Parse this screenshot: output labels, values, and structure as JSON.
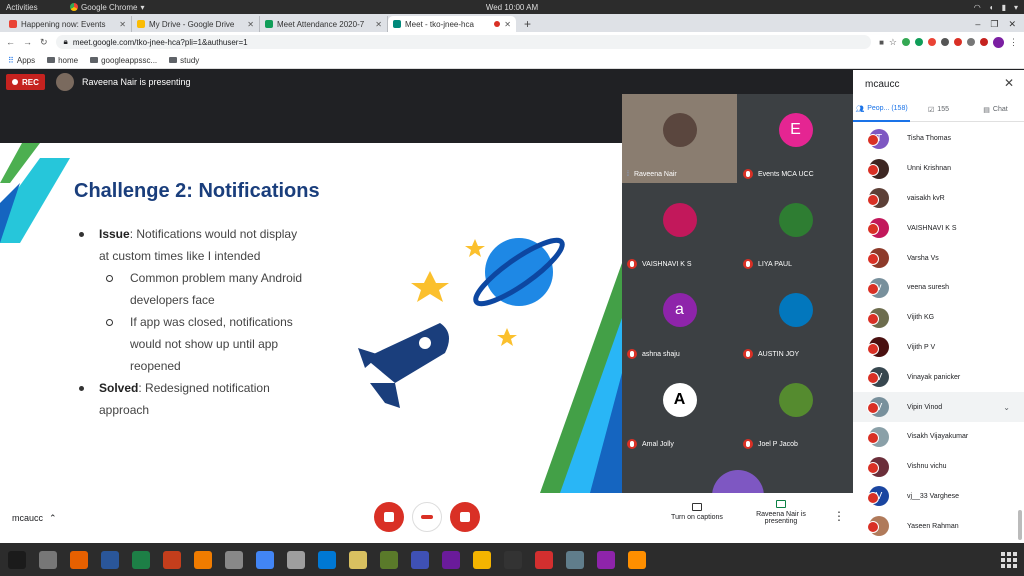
{
  "system": {
    "activities": "Activities",
    "app_menu": "Google Chrome",
    "clock": "Wed 10:00 AM"
  },
  "browser": {
    "tabs": [
      {
        "label": "Happening now: Events",
        "color": "#ea4335"
      },
      {
        "label": "My Drive - Google Drive",
        "color": "#fbbc04"
      },
      {
        "label": "Meet Attendance 2020-7",
        "color": "#0f9d58"
      },
      {
        "label": "Meet - tko-jnee-hca",
        "color": "#00897b",
        "active": true
      }
    ],
    "url": "meet.google.com/tko-jnee-hca?pli=1&authuser=1",
    "bookmarks": [
      "Apps",
      "home",
      "googleappssc...",
      "study"
    ]
  },
  "meet": {
    "rec_label": "REC",
    "presenting_text": "Raveena Nair is presenting",
    "slide": {
      "title": "Challenge 2: Notifications",
      "b1_head": "Issue",
      "b1_text": ": Notifications would not display at custom times like I intended",
      "b1_sub1": "Common problem many Android developers face",
      "b1_sub2": "If app was closed, notifications would not show up until app reopened",
      "b2_head": "Solved",
      "b2_text": ": Redesigned notification approach"
    },
    "tiles": [
      {
        "name": "Raveena Nair",
        "avatar": "",
        "color": "#6d5b52"
      },
      {
        "name": "Events MCA UCC",
        "avatar": "E",
        "color": "#e52592"
      },
      {
        "name": "VAISHNAVI K S",
        "avatar": "",
        "color": "#c2185b"
      },
      {
        "name": "LIYA PAUL",
        "avatar": "",
        "color": "#2e7d32"
      },
      {
        "name": "ashna shaju",
        "avatar": "a",
        "color": "#8e24aa"
      },
      {
        "name": "AUSTIN JOY",
        "avatar": "",
        "color": "#0277bd"
      },
      {
        "name": "Amal Jolly",
        "avatar": "A",
        "color": "#ffffff"
      },
      {
        "name": "Joel P Jacob",
        "avatar": "",
        "color": "#558b2f"
      }
    ],
    "bottom": {
      "meeting_name": "mcaucc",
      "captions": "Turn on captions",
      "presenting": "Raveena Nair is presenting"
    },
    "sidebar": {
      "title": "mcaucc",
      "tab_people": "Peop... (158)",
      "tab_count": "155",
      "tab_chat": "Chat",
      "people": [
        {
          "name": "Tisha Thomas",
          "avatar": "T",
          "color": "#7e57c2"
        },
        {
          "name": "Unni Krishnan",
          "avatar": "",
          "color": "#3e2723"
        },
        {
          "name": "vaisakh kvR",
          "avatar": "",
          "color": "#5d4037"
        },
        {
          "name": "VAISHNAVI K S",
          "avatar": "",
          "color": "#c2185b"
        },
        {
          "name": "Varsha Vs",
          "avatar": "",
          "color": "#8d3a2a"
        },
        {
          "name": "veena suresh",
          "avatar": "v",
          "color": "#78909c"
        },
        {
          "name": "Vijith KG",
          "avatar": "",
          "color": "#6d6d4e"
        },
        {
          "name": "Vijith P V",
          "avatar": "",
          "color": "#4a1010"
        },
        {
          "name": "Vinayak panicker",
          "avatar": "V",
          "color": "#37474f"
        },
        {
          "name": "Vipin Vinod",
          "avatar": "V",
          "color": "#78909c",
          "hl": true
        },
        {
          "name": "Visakh Vijayakumar",
          "avatar": "",
          "color": "#8aa0a8"
        },
        {
          "name": "Vishnu vichu",
          "avatar": "",
          "color": "#6b2e3a"
        },
        {
          "name": "vj__33 Varghese",
          "avatar": "V",
          "color": "#1a45a0"
        },
        {
          "name": "Yaseen Rahman",
          "avatar": "",
          "color": "#b07a5a"
        }
      ]
    }
  },
  "taskbar": {
    "apps": [
      "#1b1b1b",
      "#777777",
      "#e66000",
      "#2a5699",
      "#1d7f46",
      "#c43e1c",
      "#f07c00",
      "#888888",
      "#4285f4",
      "#9e9e9e",
      "#0078d4",
      "#d8c060",
      "#5a7a2a",
      "#3f51b5",
      "#6a1b9a",
      "#f4b400",
      "#333333",
      "#d32f2f",
      "#607d8b",
      "#8e24aa",
      "#ff8f00"
    ]
  }
}
